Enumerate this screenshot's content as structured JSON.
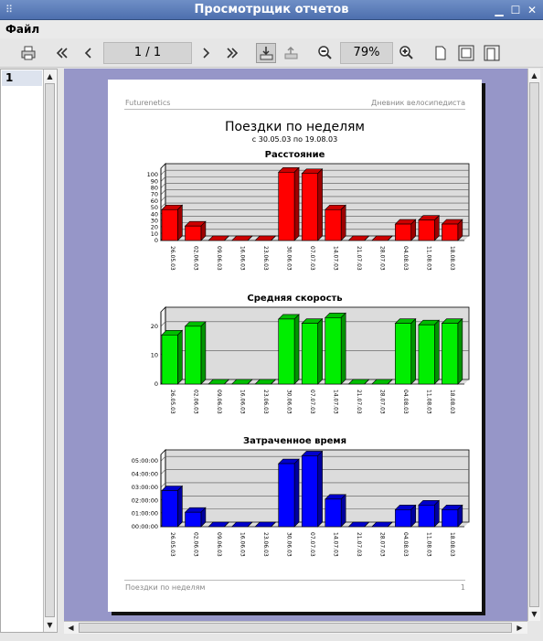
{
  "window": {
    "title": "Просмотрщик отчетов",
    "grip": "⠿",
    "min": "▁",
    "max": "☐",
    "close": "✕"
  },
  "menu": {
    "file": "Файл"
  },
  "toolbar": {
    "page": "1 / 1",
    "zoom": "79%"
  },
  "icons": [
    "print-icon",
    "first-page-icon",
    "prev-page-icon",
    "next-page-icon",
    "last-page-icon",
    "export-icon",
    "upload-icon",
    "zoom-out-icon",
    "zoom-in-icon",
    "page-icon",
    "fit-page-icon",
    "fit-width-icon"
  ],
  "pages_panel": {
    "item": "1"
  },
  "report": {
    "header_left": "Futurenetics",
    "header_right": "Дневник велосипедиста",
    "title": "Поездки по неделям",
    "subtitle": "с 30.05.03 по 19.08.03",
    "footer_left": "Поездки по неделям",
    "footer_right": "1"
  },
  "chart_data": [
    {
      "type": "bar",
      "title": "Расстояние",
      "categories": [
        "26.05.03",
        "02.06.03",
        "09.06.03",
        "16.06.03",
        "23.06.03",
        "30.06.03",
        "07.07.03",
        "14.07.03",
        "21.07.03",
        "28.07.03",
        "04.08.03",
        "11.08.03",
        "18.08.03"
      ],
      "values": [
        47,
        22,
        0,
        0,
        0,
        104,
        102,
        47,
        0,
        0,
        25,
        31,
        25
      ],
      "ylim": [
        0,
        110
      ],
      "yticks": [
        "0",
        "10",
        "20",
        "30",
        "40",
        "50",
        "60",
        "70",
        "80",
        "90",
        "100"
      ],
      "ytick_values": [
        0,
        10,
        20,
        30,
        40,
        50,
        60,
        70,
        80,
        90,
        100
      ],
      "grid": true,
      "color": "#ff0000"
    },
    {
      "type": "bar",
      "title": "Средняя скорость",
      "categories": [
        "26.05.03",
        "02.06.03",
        "09.06.03",
        "16.06.03",
        "23.06.03",
        "30.06.03",
        "07.07.03",
        "14.07.03",
        "21.07.03",
        "28.07.03",
        "04.08.03",
        "11.08.03",
        "18.08.03"
      ],
      "values": [
        17,
        20,
        0,
        0,
        0,
        22.5,
        21,
        23,
        0,
        0,
        21,
        20.5,
        21
      ],
      "ylim": [
        0,
        25
      ],
      "yticks": [
        "0",
        "10",
        "20"
      ],
      "ytick_values": [
        0,
        10,
        20
      ],
      "grid": true,
      "color": "#00ee00"
    },
    {
      "type": "bar",
      "title": "Затраченное время",
      "categories": [
        "26.05.03",
        "02.06.03",
        "09.06.03",
        "16.06.03",
        "23.06.03",
        "30.06.03",
        "07.07.03",
        "14.07.03",
        "21.07.03",
        "28.07.03",
        "04.08.03",
        "11.08.03",
        "18.08.03"
      ],
      "values": [
        2.75,
        1.1,
        0,
        0,
        0,
        4.8,
        5.4,
        2.1,
        0,
        0,
        1.3,
        1.65,
        1.3
      ],
      "ylim": [
        0,
        5.5
      ],
      "yticks": [
        "00:00:00",
        "01:00:00",
        "02:00:00",
        "03:00:00",
        "04:00:00",
        "05:00:00"
      ],
      "ytick_values": [
        0,
        1,
        2,
        3,
        4,
        5
      ],
      "grid": true,
      "color": "#0000ff"
    }
  ]
}
